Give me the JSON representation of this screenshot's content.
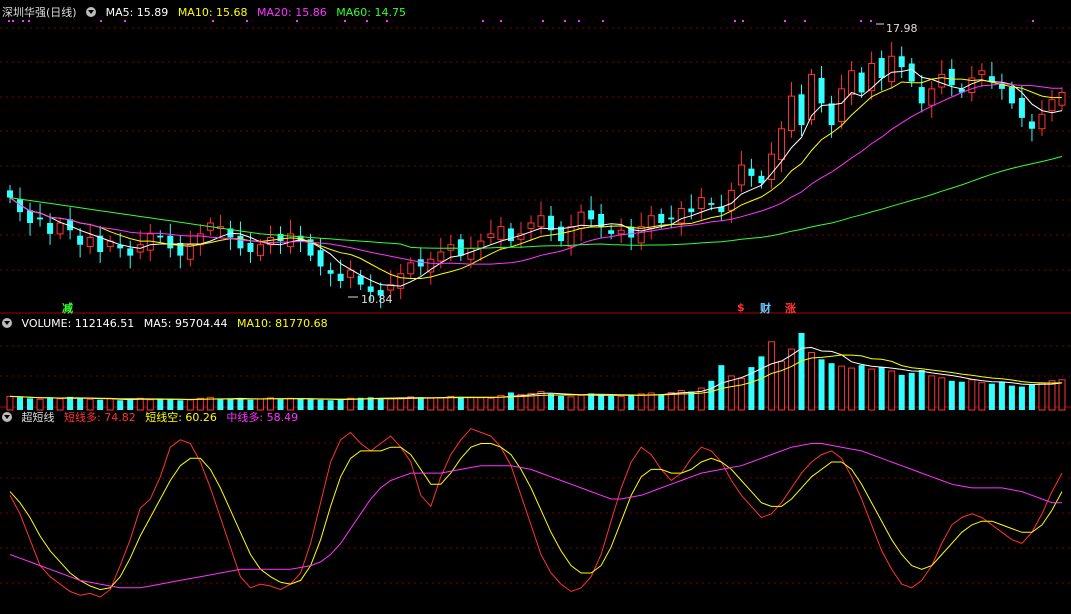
{
  "price_panel": {
    "title": "深圳华强(日线)",
    "indicators": [
      {
        "label": "MA5: 15.89",
        "color": "#ffffff"
      },
      {
        "label": "MA10: 15.68",
        "color": "#ffff00"
      },
      {
        "label": "MA20: 15.86",
        "color": "#ff33ff"
      },
      {
        "label": "MA60: 14.75",
        "color": "#33ff33"
      }
    ],
    "high_label": "17.98",
    "low_label": "10.84",
    "tags": [
      {
        "text": "减",
        "color": "#33ff33"
      },
      {
        "text": "$",
        "color": "#ff3333"
      },
      {
        "text": "财",
        "color": "#66ccff"
      },
      {
        "text": "涨",
        "color": "#ff3333"
      }
    ]
  },
  "volume_panel": {
    "indicators": [
      {
        "label": "VOLUME: 112146.51",
        "color": "#ffffff"
      },
      {
        "label": "MA5: 95704.44",
        "color": "#ffffff"
      },
      {
        "label": "MA10: 81770.68",
        "color": "#ffff00"
      }
    ]
  },
  "oscillator_panel": {
    "title": "超短线",
    "indicators": [
      {
        "label": "短线多: 74.82",
        "color": "#ff3333"
      },
      {
        "label": "短线空: 60.26",
        "color": "#ffff00"
      },
      {
        "label": "中线多: 58.49",
        "color": "#ff33ff"
      }
    ]
  },
  "chart_data": [
    {
      "type": "candlestick",
      "panel": "price",
      "ylim": [
        10.5,
        18.5
      ],
      "x": "daily bars, left to right",
      "closes": [
        13.6,
        13.2,
        12.9,
        13.0,
        12.6,
        12.9,
        12.7,
        12.3,
        12.5,
        12.1,
        12.4,
        12.2,
        12.0,
        12.3,
        12.6,
        12.5,
        12.2,
        12.0,
        12.3,
        12.6,
        12.9,
        12.8,
        12.5,
        12.2,
        12.1,
        12.3,
        12.5,
        12.4,
        12.6,
        12.4,
        12.0,
        11.7,
        11.5,
        11.3,
        11.6,
        11.2,
        11.0,
        10.9,
        11.2,
        11.5,
        11.8,
        11.7,
        11.9,
        12.1,
        12.3,
        12.0,
        12.2,
        12.4,
        12.6,
        12.8,
        12.4,
        12.6,
        12.9,
        13.1,
        12.7,
        12.4,
        12.8,
        13.2,
        13.0,
        12.8,
        12.6,
        12.7,
        12.5,
        12.8,
        13.1,
        12.9,
        13.0,
        13.3,
        13.2,
        13.6,
        13.4,
        13.2,
        13.8,
        14.5,
        14.2,
        14.0,
        14.8,
        15.5,
        16.4,
        15.6,
        17.0,
        16.2,
        15.6,
        16.6,
        17.1,
        16.5,
        17.3,
        16.9,
        17.5,
        17.2,
        16.8,
        16.2,
        16.6,
        17.0,
        16.7,
        16.5,
        16.9,
        17.1,
        16.8,
        16.6,
        16.2,
        15.8,
        15.5,
        15.9,
        16.3,
        16.5
      ],
      "high": 17.98,
      "low": 10.84
    },
    {
      "type": "line",
      "panel": "price",
      "series": [
        {
          "name": "MA5",
          "color": "#ffffff"
        },
        {
          "name": "MA10",
          "color": "#ffff00"
        },
        {
          "name": "MA20",
          "color": "#ff33ff"
        },
        {
          "name": "MA60",
          "color": "#33ff33"
        }
      ]
    },
    {
      "type": "bar",
      "panel": "volume",
      "values": [
        28,
        26,
        24,
        22,
        25,
        23,
        27,
        24,
        22,
        21,
        23,
        20,
        22,
        24,
        21,
        23,
        22,
        20,
        21,
        24,
        26,
        23,
        22,
        24,
        21,
        23,
        25,
        22,
        24,
        23,
        22,
        21,
        20,
        22,
        24,
        25,
        26,
        24,
        23,
        25,
        27,
        26,
        24,
        25,
        28,
        27,
        26,
        25,
        24,
        30,
        36,
        32,
        34,
        38,
        33,
        29,
        27,
        30,
        34,
        31,
        29,
        28,
        30,
        33,
        35,
        32,
        36,
        40,
        38,
        45,
        60,
        92,
        70,
        65,
        88,
        110,
        140,
        100,
        125,
        158,
        118,
        104,
        96,
        90,
        86,
        92,
        84,
        88,
        80,
        72,
        76,
        82,
        70,
        66,
        60,
        58,
        62,
        56,
        54,
        58,
        50,
        48,
        52,
        56,
        60,
        62
      ],
      "series": [
        {
          "name": "MA5",
          "color": "#ffffff"
        },
        {
          "name": "MA10",
          "color": "#ffff00"
        }
      ]
    },
    {
      "type": "line",
      "panel": "oscillator",
      "ylim": [
        0,
        100
      ],
      "series": [
        {
          "name": "短线多",
          "color": "#ff3333",
          "values": [
            62,
            52,
            38,
            24,
            18,
            14,
            10,
            8,
            9,
            7,
            11,
            24,
            38,
            55,
            60,
            72,
            88,
            92,
            90,
            80,
            66,
            50,
            34,
            18,
            12,
            14,
            13,
            11,
            14,
            20,
            36,
            58,
            80,
            92,
            96,
            90,
            86,
            90,
            94,
            88,
            80,
            62,
            56,
            72,
            84,
            92,
            98,
            96,
            94,
            88,
            78,
            62,
            46,
            30,
            20,
            14,
            10,
            12,
            18,
            30,
            48,
            66,
            80,
            88,
            84,
            76,
            70,
            74,
            82,
            88,
            86,
            80,
            70,
            62,
            56,
            50,
            52,
            58,
            66,
            74,
            80,
            84,
            86,
            82,
            72,
            60,
            46,
            32,
            22,
            14,
            12,
            16,
            24,
            36,
            46,
            50,
            52,
            50,
            46,
            42,
            38,
            36,
            42,
            52,
            64,
            74
          ]
        },
        {
          "name": "短线空",
          "color": "#ffff00",
          "values": [
            64,
            58,
            50,
            40,
            32,
            26,
            20,
            16,
            13,
            11,
            12,
            18,
            28,
            40,
            50,
            60,
            70,
            78,
            82,
            82,
            76,
            66,
            54,
            42,
            30,
            22,
            18,
            15,
            14,
            16,
            24,
            38,
            56,
            72,
            82,
            86,
            86,
            86,
            88,
            88,
            84,
            76,
            68,
            68,
            74,
            82,
            88,
            90,
            90,
            88,
            84,
            76,
            66,
            54,
            42,
            32,
            24,
            20,
            20,
            24,
            34,
            48,
            62,
            72,
            76,
            76,
            74,
            74,
            76,
            80,
            82,
            80,
            76,
            70,
            64,
            58,
            56,
            56,
            60,
            66,
            72,
            76,
            80,
            80,
            76,
            68,
            58,
            48,
            38,
            30,
            24,
            22,
            24,
            30,
            36,
            42,
            46,
            48,
            48,
            46,
            44,
            42,
            42,
            46,
            54,
            64
          ]
        },
        {
          "name": "中线多",
          "color": "#ff33ff",
          "values": [
            30,
            28,
            26,
            24,
            22,
            20,
            18,
            16,
            15,
            14,
            13,
            12,
            12,
            12,
            13,
            14,
            15,
            16,
            17,
            18,
            19,
            20,
            21,
            22,
            22,
            22,
            22,
            22,
            22,
            23,
            24,
            26,
            30,
            36,
            44,
            52,
            60,
            66,
            70,
            72,
            74,
            74,
            74,
            74,
            75,
            76,
            77,
            78,
            78,
            78,
            78,
            77,
            76,
            74,
            72,
            70,
            68,
            66,
            64,
            62,
            60,
            60,
            61,
            62,
            64,
            66,
            68,
            70,
            72,
            74,
            75,
            76,
            77,
            78,
            80,
            82,
            84,
            86,
            88,
            89,
            90,
            90,
            89,
            88,
            87,
            86,
            84,
            82,
            80,
            78,
            76,
            74,
            72,
            70,
            68,
            67,
            66,
            66,
            66,
            66,
            65,
            64,
            62,
            60,
            58,
            58
          ]
        }
      ]
    }
  ]
}
